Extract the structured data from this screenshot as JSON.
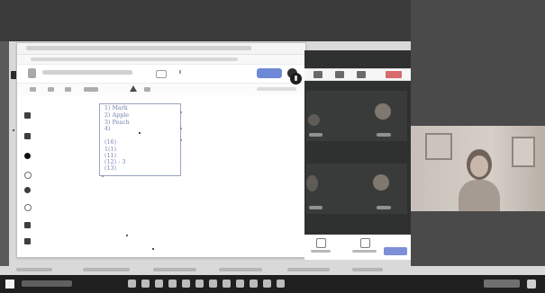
{
  "handwriting": {
    "lines": [
      "1) Mark",
      "2) Apple",
      "3) Peach",
      "4)",
      "",
      "(16)",
      "1(1)",
      "(11)",
      "(12) - 3",
      "(13)"
    ]
  }
}
